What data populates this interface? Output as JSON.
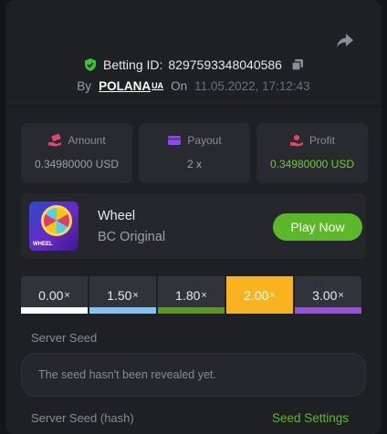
{
  "header": {
    "betting_id_label": "Betting ID:",
    "betting_id": "8297593348040586",
    "by_label": "By",
    "username": "POLANA",
    "username_suffix": "UA",
    "on_label": "On",
    "datetime": "11.05.2022, 17:12:43"
  },
  "stats": [
    {
      "label": "Amount",
      "value": "0.34980000 USD",
      "icon": "money-hand-icon"
    },
    {
      "label": "Payout",
      "value": "2 x",
      "icon": "wallet-card-icon"
    },
    {
      "label": "Profit",
      "value": "0.34980000 USD",
      "icon": "profit-hand-icon"
    }
  ],
  "game": {
    "name": "Wheel",
    "provider": "BC Original",
    "thumb_label": "WHEEL",
    "play_label": "Play Now"
  },
  "multipliers": [
    {
      "value": "0.00",
      "suffix": "×",
      "color": "#ffffff",
      "active": false
    },
    {
      "value": "1.50",
      "suffix": "×",
      "color": "#7fc3f7",
      "active": false
    },
    {
      "value": "1.80",
      "suffix": "×",
      "color": "#5c9a1e",
      "active": false
    },
    {
      "value": "2.00",
      "suffix": "×",
      "color": "#f9b31f",
      "active": true
    },
    {
      "value": "3.00",
      "suffix": "×",
      "color": "#9b4de0",
      "active": false
    }
  ],
  "seeds": {
    "server_seed_label": "Server Seed",
    "server_seed_value": "The seed hasn't been revealed yet.",
    "server_seed_hash_label": "Server Seed (hash)",
    "seed_settings_label": "Seed Settings"
  },
  "colors": {
    "accent_green": "#5cb82a",
    "profit_green": "#6ccf2e",
    "active_mult": "#f9b31f",
    "icon_pink": "#e2446d",
    "icon_purple": "#8c4fe6"
  }
}
